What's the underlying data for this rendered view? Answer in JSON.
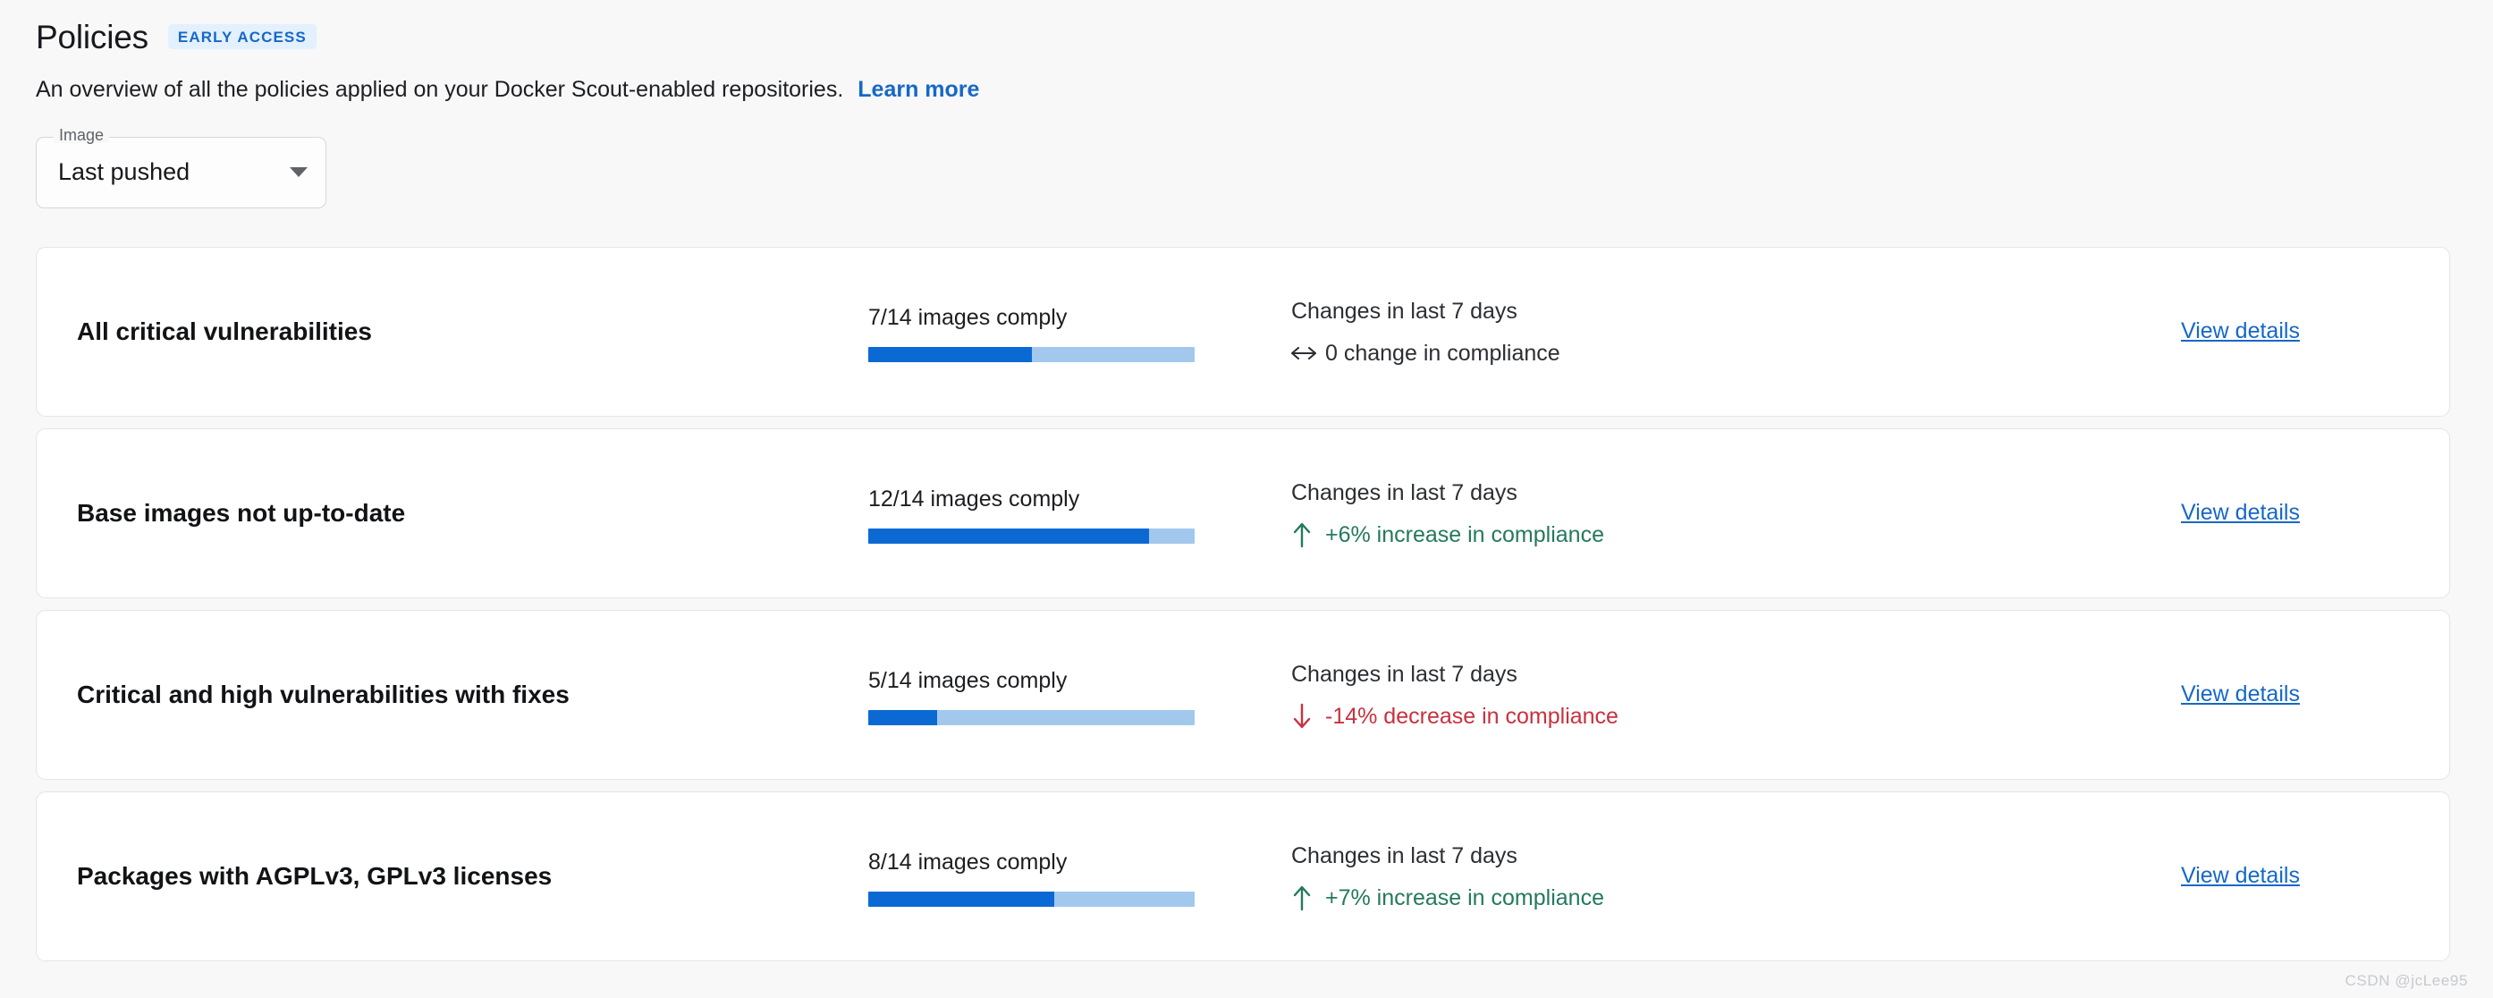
{
  "header": {
    "title": "Policies",
    "badge": "EARLY ACCESS",
    "description": "An overview of all the policies applied on your Docker Scout-enabled repositories.",
    "learn_more_label": "Learn more"
  },
  "filter": {
    "label": "Image",
    "value": "Last pushed",
    "icon": "chevron-down-icon"
  },
  "colors": {
    "link_blue": "#1668c6",
    "progress_fill": "#0b69d4",
    "progress_track": "#a2c8ee",
    "increase_green": "#24795e",
    "decrease_red": "#c8313f",
    "neutral_gray": "#2b2e33",
    "badge_bg": "#e3f0fd"
  },
  "action_label": "View details",
  "changes_label": "Changes in last 7 days",
  "policies": [
    {
      "name": "All critical vulnerabilities",
      "comply_text": "7/14 images comply",
      "complied": 7,
      "total": 14,
      "percent": 50,
      "change_icon": "left-right-arrow-icon",
      "change_text": "0 change in compliance",
      "change_direction": "neutral",
      "view_details": "View details",
      "changes_label": "Changes in last 7 days"
    },
    {
      "name": "Base images not up-to-date",
      "comply_text": "12/14 images comply",
      "complied": 12,
      "total": 14,
      "percent": 86,
      "change_icon": "arrow-up-icon",
      "change_text": "+6% increase in compliance",
      "change_direction": "up",
      "view_details": "View details",
      "changes_label": "Changes in last 7 days"
    },
    {
      "name": "Critical and high vulnerabilities with fixes",
      "comply_text": "5/14 images comply",
      "complied": 5,
      "total": 14,
      "percent": 21,
      "change_icon": "arrow-down-icon",
      "change_text": "-14% decrease in compliance",
      "change_direction": "down",
      "view_details": "View details",
      "changes_label": "Changes in last 7 days"
    },
    {
      "name": "Packages with AGPLv3, GPLv3 licenses",
      "comply_text": "8/14 images comply",
      "complied": 8,
      "total": 14,
      "percent": 57,
      "change_icon": "arrow-up-icon",
      "change_text": "+7% increase in compliance",
      "change_direction": "up",
      "view_details": "View details",
      "changes_label": "Changes in last 7 days"
    }
  ],
  "watermark": "CSDN @jcLee95"
}
